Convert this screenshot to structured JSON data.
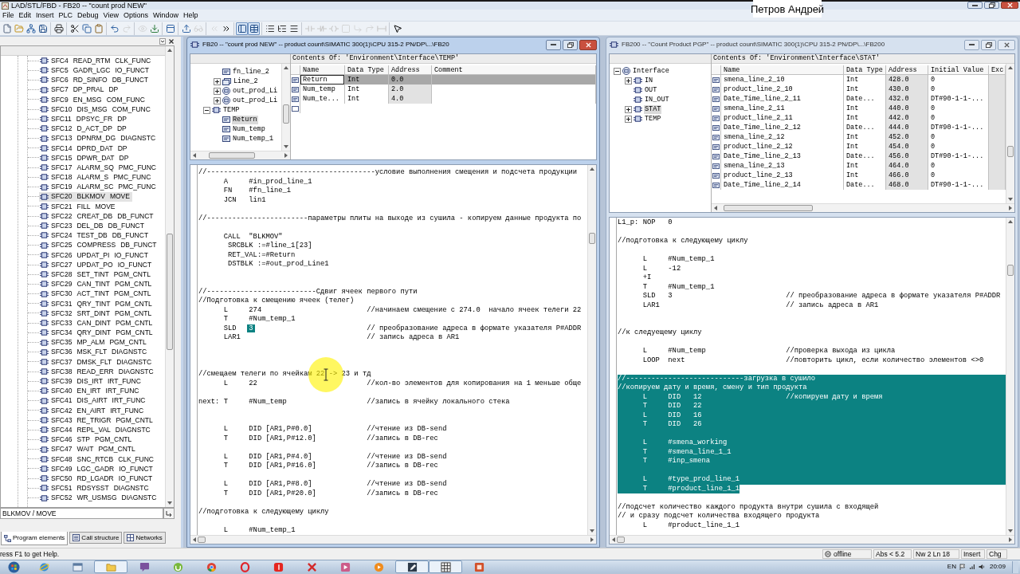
{
  "window": {
    "title": "LAD/STL/FBD - FB20 -- \"count prod NEW\""
  },
  "caption": "Петров Андрей",
  "menu": [
    "File",
    "Edit",
    "Insert",
    "PLC",
    "Debug",
    "View",
    "Options",
    "Window",
    "Help"
  ],
  "toolbar": [
    [
      {
        "kind": "new",
        "disabled": false,
        "pressed": false
      },
      {
        "kind": "open",
        "disabled": false,
        "pressed": false
      },
      {
        "kind": "nodes",
        "disabled": false,
        "pressed": false
      },
      {
        "kind": "save",
        "disabled": false,
        "pressed": false
      }
    ],
    [
      {
        "kind": "print",
        "disabled": false,
        "pressed": false
      }
    ],
    [
      {
        "kind": "cut",
        "disabled": false,
        "pressed": false
      },
      {
        "kind": "copy",
        "disabled": false,
        "pressed": false
      },
      {
        "kind": "paste",
        "disabled": false,
        "pressed": false
      }
    ],
    [
      {
        "kind": "undo",
        "disabled": false,
        "pressed": false
      },
      {
        "kind": "redo",
        "disabled": true,
        "pressed": false
      }
    ],
    [
      {
        "kind": "monitor",
        "disabled": true,
        "pressed": false
      },
      {
        "kind": "download",
        "disabled": false,
        "pressed": false
      }
    ],
    [
      {
        "kind": "window",
        "disabled": false,
        "pressed": false
      }
    ],
    [
      {
        "kind": "upload",
        "disabled": false,
        "pressed": false
      },
      {
        "kind": "glasses",
        "disabled": true,
        "pressed": false
      }
    ],
    [
      {
        "kind": "prev",
        "disabled": true,
        "pressed": false
      },
      {
        "kind": "next",
        "disabled": false,
        "pressed": false
      }
    ],
    [
      {
        "kind": "overview",
        "disabled": false,
        "pressed": true
      },
      {
        "kind": "details",
        "disabled": false,
        "pressed": true
      }
    ],
    [
      {
        "kind": "list",
        "disabled": false,
        "pressed": false
      },
      {
        "kind": "tree",
        "disabled": false,
        "pressed": false
      },
      {
        "kind": "lines",
        "disabled": false,
        "pressed": false
      }
    ],
    [
      {
        "kind": "contact",
        "disabled": true,
        "pressed": false
      },
      {
        "kind": "contact_nc",
        "disabled": true,
        "pressed": false
      },
      {
        "kind": "coil",
        "disabled": true,
        "pressed": false
      },
      {
        "kind": "box",
        "disabled": true,
        "pressed": false
      },
      {
        "kind": "branch_open",
        "disabled": true,
        "pressed": false
      },
      {
        "kind": "branch_close",
        "disabled": true,
        "pressed": false
      },
      {
        "kind": "connect",
        "disabled": true,
        "pressed": false
      }
    ],
    [
      {
        "kind": "help",
        "disabled": false,
        "pressed": false
      }
    ]
  ],
  "program_elements": {
    "items": [
      {
        "block": "SFC4",
        "name": "READ_RTM",
        "family": "CLK_FUNC",
        "selected": false
      },
      {
        "block": "SFC5",
        "name": "GADR_LGC",
        "family": "IO_FUNCT",
        "selected": false
      },
      {
        "block": "SFC6",
        "name": "RD_SINFO",
        "family": "DB_FUNCT",
        "selected": false
      },
      {
        "block": "SFC7",
        "name": "DP_PRAL",
        "family": "DP",
        "selected": false
      },
      {
        "block": "SFC9",
        "name": "EN_MSG",
        "family": "COM_FUNC",
        "selected": false
      },
      {
        "block": "SFC10",
        "name": "DIS_MSG",
        "family": "COM_FUNC",
        "selected": false
      },
      {
        "block": "SFC11",
        "name": "DPSYC_FR",
        "family": "DP",
        "selected": false
      },
      {
        "block": "SFC12",
        "name": "D_ACT_DP",
        "family": "DP",
        "selected": false
      },
      {
        "block": "SFC13",
        "name": "DPNRM_DG",
        "family": "DIAGNSTC",
        "selected": false
      },
      {
        "block": "SFC14",
        "name": "DPRD_DAT",
        "family": "DP",
        "selected": false
      },
      {
        "block": "SFC15",
        "name": "DPWR_DAT",
        "family": "DP",
        "selected": false
      },
      {
        "block": "SFC17",
        "name": "ALARM_SQ",
        "family": "PMC_FUNC",
        "selected": false
      },
      {
        "block": "SFC18",
        "name": "ALARM_S",
        "family": "PMC_FUNC",
        "selected": false
      },
      {
        "block": "SFC19",
        "name": "ALARM_SC",
        "family": "PMC_FUNC",
        "selected": false
      },
      {
        "block": "SFC20",
        "name": "BLKMOV",
        "family": "MOVE",
        "selected": true
      },
      {
        "block": "SFC21",
        "name": "FILL",
        "family": "MOVE",
        "selected": false
      },
      {
        "block": "SFC22",
        "name": "CREAT_DB",
        "family": "DB_FUNCT",
        "selected": false
      },
      {
        "block": "SFC23",
        "name": "DEL_DB",
        "family": "DB_FUNCT",
        "selected": false
      },
      {
        "block": "SFC24",
        "name": "TEST_DB",
        "family": "DB_FUNCT",
        "selected": false
      },
      {
        "block": "SFC25",
        "name": "COMPRESS",
        "family": "DB_FUNCT",
        "selected": false
      },
      {
        "block": "SFC26",
        "name": "UPDAT_PI",
        "family": "IO_FUNCT",
        "selected": false
      },
      {
        "block": "SFC27",
        "name": "UPDAT_PO",
        "family": "IO_FUNCT",
        "selected": false
      },
      {
        "block": "SFC28",
        "name": "SET_TINT",
        "family": "PGM_CNTL",
        "selected": false
      },
      {
        "block": "SFC29",
        "name": "CAN_TINT",
        "family": "PGM_CNTL",
        "selected": false
      },
      {
        "block": "SFC30",
        "name": "ACT_TINT",
        "family": "PGM_CNTL",
        "selected": false
      },
      {
        "block": "SFC31",
        "name": "QRY_TINT",
        "family": "PGM_CNTL",
        "selected": false
      },
      {
        "block": "SFC32",
        "name": "SRT_DINT",
        "family": "PGM_CNTL",
        "selected": false
      },
      {
        "block": "SFC33",
        "name": "CAN_DINT",
        "family": "PGM_CNTL",
        "selected": false
      },
      {
        "block": "SFC34",
        "name": "QRY_DINT",
        "family": "PGM_CNTL",
        "selected": false
      },
      {
        "block": "SFC35",
        "name": "MP_ALM",
        "family": "PGM_CNTL",
        "selected": false
      },
      {
        "block": "SFC36",
        "name": "MSK_FLT",
        "family": "DIAGNSTC",
        "selected": false
      },
      {
        "block": "SFC37",
        "name": "DMSK_FLT",
        "family": "DIAGNSTC",
        "selected": false
      },
      {
        "block": "SFC38",
        "name": "READ_ERR",
        "family": "DIAGNSTC",
        "selected": false
      },
      {
        "block": "SFC39",
        "name": "DIS_IRT",
        "family": "IRT_FUNC",
        "selected": false
      },
      {
        "block": "SFC40",
        "name": "EN_IRT",
        "family": "IRT_FUNC",
        "selected": false
      },
      {
        "block": "SFC41",
        "name": "DIS_AIRT",
        "family": "IRT_FUNC",
        "selected": false
      },
      {
        "block": "SFC42",
        "name": "EN_AIRT",
        "family": "IRT_FUNC",
        "selected": false
      },
      {
        "block": "SFC43",
        "name": "RE_TRIGR",
        "family": "PGM_CNTL",
        "selected": false
      },
      {
        "block": "SFC44",
        "name": "REPL_VAL",
        "family": "DIAGNSTC",
        "selected": false
      },
      {
        "block": "SFC46",
        "name": "STP",
        "family": "PGM_CNTL",
        "selected": false
      },
      {
        "block": "SFC47",
        "name": "WAIT",
        "family": "PGM_CNTL",
        "selected": false
      },
      {
        "block": "SFC48",
        "name": "SNC_RTCB",
        "family": "CLK_FUNC",
        "selected": false
      },
      {
        "block": "SFC49",
        "name": "LGC_GADR",
        "family": "IO_FUNCT",
        "selected": false
      },
      {
        "block": "SFC50",
        "name": "RD_LGADR",
        "family": "IO_FUNCT",
        "selected": false
      },
      {
        "block": "SFC51",
        "name": "RDSYSST",
        "family": "DIAGNSTC",
        "selected": false
      },
      {
        "block": "SFC52",
        "name": "WR_USMSG",
        "family": "DIAGNSTC",
        "selected": false
      }
    ],
    "info": "BLKMOV / MOVE",
    "tabs": [
      {
        "label": "Program elements",
        "kind": "elements",
        "selected": true
      },
      {
        "label": "Call structure",
        "kind": "calls",
        "selected": false
      },
      {
        "label": "Networks",
        "kind": "networks",
        "selected": false
      }
    ]
  },
  "editors": [
    {
      "title": "FB20 -- \"count prod NEW\" -- product count\\SIMATIC 300(1)\\CPU 315-2 PN/DP\\...\\FB20",
      "active": true,
      "interface": {
        "tree": [
          {
            "children": [
              {
                "label": "fn_line_2",
                "kind": "variable",
                "selected": false
              },
              {
                "label": "Line_2",
                "kind": "array",
                "expanded": false,
                "selected": false
              },
              {
                "label": "out_prod_Li",
                "kind": "struct",
                "expanded": false,
                "selected": false
              },
              {
                "label": "out_prod_Li",
                "kind": "struct",
                "expanded": false,
                "selected": false
              }
            ]
          },
          {
            "label": "TEMP",
            "kind": "section",
            "expanded": true,
            "selected": false,
            "children": [
              {
                "label": "Return",
                "kind": "variable",
                "selected": true
              },
              {
                "label": "Num_temp",
                "kind": "variable",
                "selected": false
              },
              {
                "label": "Num_temp_1",
                "kind": "variable",
                "selected": false
              }
            ]
          }
        ],
        "heading": "Contents Of: 'Environment\\Interface\\TEMP'",
        "columns": [
          "Name",
          "Data Type",
          "Address",
          "Comment"
        ],
        "rows": [
          {
            "cells": [
              "Return",
              "Int",
              "0.0"
            ],
            "selected": true
          },
          {
            "cells": [
              "Num_temp",
              "Int",
              "2.0"
            ],
            "selected": false
          },
          {
            "cells": [
              "Num_te...",
              "Int",
              "4.0"
            ],
            "selected": false
          }
        ]
      },
      "code": [
        {
          "kind": "comment",
          "text": "//----------------------------------------условие выполнения смещения и подсчета продукции",
          "selected": false
        },
        {
          "kind": "instruction",
          "op": "A",
          "operand": "#in_prod_line_1",
          "selected": false
        },
        {
          "kind": "instruction",
          "op": "FN",
          "operand": "#fn_line_1",
          "selected": false
        },
        {
          "kind": "instruction",
          "op": "JCN",
          "operand": "lin1",
          "selected": false
        },
        {
          "kind": "blank",
          "selected": false
        },
        {
          "kind": "comment",
          "text": "//------------------------параметры плиты на выходе из сушила - копируем данные продукта по",
          "selected": false
        },
        {
          "kind": "blank",
          "selected": false
        },
        {
          "kind": "instruction",
          "op": "CALL",
          "operand": "\"BLKMOV\"",
          "selected": false
        },
        {
          "kind": "parameter",
          "text": "SRCBLK :=#line_1[23]",
          "selected": false
        },
        {
          "kind": "parameter",
          "text": "RET_VAL:=#Return",
          "selected": false
        },
        {
          "kind": "parameter",
          "text": "DSTBLK :=#out_prod_Line1",
          "selected": false
        },
        {
          "kind": "blank",
          "selected": false
        },
        {
          "kind": "blank",
          "selected": false
        },
        {
          "kind": "comment",
          "text": "//--------------------------Сдвиг ячеек первого пути",
          "selected": false
        },
        {
          "kind": "comment",
          "text": "//Подготовка к смещению ячеек (телег)",
          "selected": false
        },
        {
          "kind": "instruction",
          "op": "L",
          "operand": "274",
          "comment": "//начинаем смещение с 274.0  начало ячеек телеги 22",
          "selected": false
        },
        {
          "kind": "instruction",
          "op": "T",
          "operand": "#Num_temp_1",
          "selected": false
        },
        {
          "kind": "instruction",
          "op": "SLD",
          "operand": {
            "text": "3",
            "selected": true
          },
          "comment": "// преобразование адреса в формате указателя P#ADDR",
          "selected": false
        },
        {
          "kind": "instruction",
          "op": "LAR1",
          "comment": "// запись адреса в AR1",
          "selected": false
        },
        {
          "kind": "blank",
          "selected": false
        },
        {
          "kind": "blank",
          "selected": false
        },
        {
          "kind": "blank",
          "selected": false
        },
        {
          "kind": "comment",
          "text": "//смещаем телеги по ячейкам 22 -> 23 и тд",
          "selected": false
        },
        {
          "kind": "instruction",
          "op": "L",
          "operand": "22",
          "comment": "//кол-во элементов для копирования на 1 меньше обще",
          "selected": false
        },
        {
          "kind": "blank",
          "selected": false
        },
        {
          "kind": "instruction",
          "label": "next:",
          "op": "T",
          "operand": "#Num_temp",
          "comment": "//запись в ячейку локального стека",
          "selected": false
        },
        {
          "kind": "blank",
          "selected": false
        },
        {
          "kind": "blank",
          "selected": false
        },
        {
          "kind": "instruction",
          "op": "L",
          "operand": "DID [AR1,P#0.0]",
          "comment": "//чтение из DB-send",
          "selected": false
        },
        {
          "kind": "instruction",
          "op": "T",
          "operand": "DID [AR1,P#12.0]",
          "comment": "//запись в DB-rec",
          "selected": false
        },
        {
          "kind": "blank",
          "selected": false
        },
        {
          "kind": "instruction",
          "op": "L",
          "operand": "DID [AR1,P#4.0]",
          "comment": "//чтение из DB-send",
          "selected": false
        },
        {
          "kind": "instruction",
          "op": "T",
          "operand": "DID [AR1,P#16.0]",
          "comment": "//запись в DB-rec",
          "selected": false
        },
        {
          "kind": "blank",
          "selected": false
        },
        {
          "kind": "instruction",
          "op": "L",
          "operand": "DID [AR1,P#8.0]",
          "comment": "//чтение из DB-send",
          "selected": false
        },
        {
          "kind": "instruction",
          "op": "T",
          "operand": "DID [AR1,P#20.0]",
          "comment": "//запись в DB-rec",
          "selected": false
        },
        {
          "kind": "blank",
          "selected": false
        },
        {
          "kind": "comment",
          "text": "//подготовка к следующему циклу",
          "selected": false
        },
        {
          "kind": "blank",
          "selected": false
        },
        {
          "kind": "instruction",
          "op": "L",
          "operand": "#Num_temp_1",
          "selected": false
        }
      ]
    },
    {
      "title": "FB200 -- \"Count Product PGP\" -- product count\\SIMATIC 300(1)\\CPU 315-2 PN/DP\\...\\FB200",
      "active": false,
      "interface": {
        "tree": [
          {
            "label": "Interface",
            "kind": "root",
            "expanded": true,
            "selected": false,
            "children": [
              {
                "label": "IN",
                "kind": "section",
                "expanded": false,
                "selected": false
              },
              {
                "label": "OUT",
                "kind": "section",
                "selected": false
              },
              {
                "label": "IN_OUT",
                "kind": "section",
                "selected": false
              },
              {
                "label": "STAT",
                "kind": "section",
                "expanded": false,
                "selected": true
              },
              {
                "label": "TEMP",
                "kind": "section",
                "expanded": false,
                "selected": false
              }
            ]
          }
        ],
        "heading": "Contents Of: 'Environment\\Interface\\STAT'",
        "columns": [
          "Name",
          "Data Type",
          "Address",
          "Initial Value",
          "Exc"
        ],
        "rows": [
          {
            "cells": [
              "smena_line_2_10",
              "Int",
              "428.0",
              "0"
            ],
            "selected": false
          },
          {
            "cells": [
              "product_line_2_10",
              "Int",
              "430.0",
              "0"
            ],
            "selected": false
          },
          {
            "cells": [
              "Date_Time_line_2_11",
              "Date...",
              "432.0",
              "DT#90-1-1-..."
            ],
            "selected": false
          },
          {
            "cells": [
              "smena_line_2_11",
              "Int",
              "440.0",
              "0"
            ],
            "selected": false
          },
          {
            "cells": [
              "product_line_2_11",
              "Int",
              "442.0",
              "0"
            ],
            "selected": false
          },
          {
            "cells": [
              "Date_Time_line_2_12",
              "Date...",
              "444.0",
              "DT#90-1-1-..."
            ],
            "selected": false
          },
          {
            "cells": [
              "smena_line_2_12",
              "Int",
              "452.0",
              "0"
            ],
            "selected": false
          },
          {
            "cells": [
              "product_line_2_12",
              "Int",
              "454.0",
              "0"
            ],
            "selected": false
          },
          {
            "cells": [
              "Date_Time_line_2_13",
              "Date...",
              "456.0",
              "DT#90-1-1-..."
            ],
            "selected": false
          },
          {
            "cells": [
              "smena_line_2_13",
              "Int",
              "464.0",
              "0"
            ],
            "selected": false
          },
          {
            "cells": [
              "product_line_2_13",
              "Int",
              "466.0",
              "0"
            ],
            "selected": false
          },
          {
            "cells": [
              "Date_Time_line_2_14",
              "Date...",
              "468.0",
              "DT#90-1-1-..."
            ],
            "selected": false
          }
        ]
      },
      "code": [
        {
          "kind": "instruction",
          "label": "L1_p:",
          "op": "NOP",
          "operand": "0",
          "selected": false
        },
        {
          "kind": "blank",
          "selected": false
        },
        {
          "kind": "comment",
          "text": "//подготовка к следующему циклу",
          "selected": false
        },
        {
          "kind": "blank",
          "selected": false
        },
        {
          "kind": "instruction",
          "op": "L",
          "operand": "#Num_temp_1",
          "selected": false
        },
        {
          "kind": "instruction",
          "op": "L",
          "operand": "-12",
          "selected": false
        },
        {
          "kind": "instruction",
          "op": "+I",
          "selected": false
        },
        {
          "kind": "instruction",
          "op": "T",
          "operand": "#Num_temp_1",
          "selected": false
        },
        {
          "kind": "instruction",
          "op": "SLD",
          "operand": "3",
          "comment": "// преобразование адреса в формате указателя P#ADDR",
          "selected": false
        },
        {
          "kind": "instruction",
          "op": "LAR1",
          "comment": "// запись адреса в AR1",
          "selected": false
        },
        {
          "kind": "blank",
          "selected": false
        },
        {
          "kind": "blank",
          "selected": false
        },
        {
          "kind": "comment",
          "text": "//к следуещему циклу",
          "selected": false
        },
        {
          "kind": "blank",
          "selected": false
        },
        {
          "kind": "instruction",
          "op": "L",
          "operand": "#Num_temp",
          "comment": "//проверка выхода из цикла",
          "selected": false
        },
        {
          "kind": "instruction",
          "op": "LOOP",
          "operand": "next",
          "comment": "//повторить цикл, если количество элементов <>0",
          "selected": false
        },
        {
          "kind": "blank",
          "selected": false
        },
        {
          "kind": "comment",
          "text": "//----------------------------загрузка в сушило",
          "selected": true
        },
        {
          "kind": "comment",
          "text": "//копируем дату и время, смену и тип продукта",
          "selected": true
        },
        {
          "kind": "instruction",
          "op": "L",
          "operand": "DID   12",
          "comment": "//копируем дату и время",
          "selected": true
        },
        {
          "kind": "instruction",
          "op": "T",
          "operand": "DID   22",
          "selected": true
        },
        {
          "kind": "instruction",
          "op": "L",
          "operand": "DID   16",
          "selected": true
        },
        {
          "kind": "instruction",
          "op": "T",
          "operand": "DID   26",
          "selected": true
        },
        {
          "kind": "blank",
          "selected": true
        },
        {
          "kind": "instruction",
          "op": "L",
          "operand": "#smena_working",
          "selected": true
        },
        {
          "kind": "instruction",
          "op": "T",
          "operand": "#smena_line_1_1",
          "selected": true
        },
        {
          "kind": "instruction",
          "op": "T",
          "operand": "#inp_smena",
          "selected": true
        },
        {
          "kind": "blank",
          "selected": true
        },
        {
          "kind": "instruction",
          "op": "L",
          "operand": "#type_prod_line_1",
          "selected": true
        },
        {
          "kind": "instruction",
          "op": "T",
          "operand": "#product_line_1_1",
          "selected": true
        },
        {
          "kind": "blank",
          "selected": false
        },
        {
          "kind": "comment",
          "text": "//подсчет количество каждого продукта внутри сушила с входящей",
          "selected": false
        },
        {
          "kind": "comment",
          "text": "// и сразу подсчет количества входящего продукта",
          "selected": false
        },
        {
          "kind": "instruction",
          "op": "L",
          "operand": "#product_line_1_1",
          "selected": false
        }
      ]
    }
  ],
  "status_bar": {
    "help": "ress F1 to get Help.",
    "connection": "offline",
    "fields": [
      "Abs < 5.2",
      "Nw 2 Ln 18",
      "Insert",
      "Chg"
    ]
  },
  "taskbar": {
    "apps": [
      {
        "kind": "ie",
        "open": false
      },
      {
        "kind": "explorer",
        "open": false
      },
      {
        "kind": "folder",
        "open": true
      },
      {
        "kind": "viber",
        "open": false
      },
      {
        "kind": "torrent",
        "open": false
      },
      {
        "kind": "chrome",
        "open": false
      },
      {
        "kind": "opera",
        "open": false
      },
      {
        "kind": "yandex",
        "open": false
      },
      {
        "kind": "xapp",
        "open": false
      },
      {
        "kind": "media",
        "open": false
      },
      {
        "kind": "player",
        "open": false
      },
      {
        "kind": "simatic",
        "open": true
      },
      {
        "kind": "grid",
        "open": true
      },
      {
        "kind": "office",
        "open": false
      }
    ],
    "language": "EN",
    "clock": "20:09"
  }
}
